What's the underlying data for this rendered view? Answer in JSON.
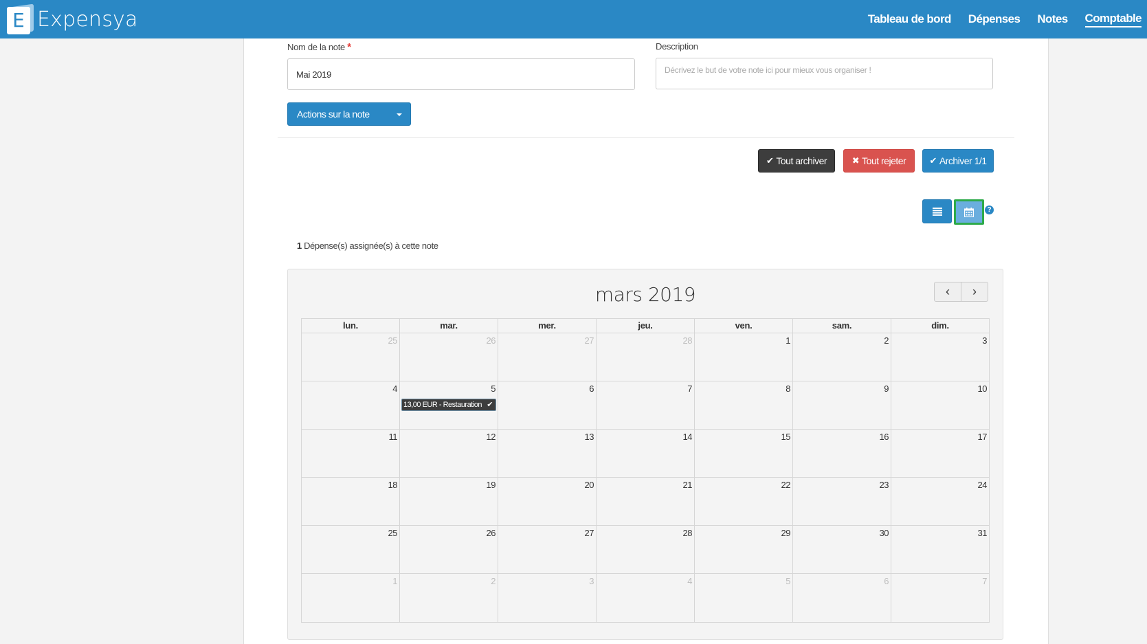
{
  "nav": {
    "logo_letter": "E",
    "brand": "Expensya",
    "links": [
      "Tableau de bord",
      "Dépenses",
      "Notes",
      "Comptable"
    ],
    "active_link": "Comptable"
  },
  "form": {
    "name_label": "Nom de la note",
    "required_mark": "*",
    "name_value": "Mai 2019",
    "description_label": "Description",
    "description_placeholder": "Décrivez le but de votre note ici pour mieux vous organiser !",
    "actions_label": "Actions sur la note"
  },
  "toolbar": {
    "archive_all": "Tout archiver",
    "reject_all": "Tout rejeter",
    "archive_count": "Archiver 1/1",
    "help": "?"
  },
  "assigned": {
    "count": "1",
    "text": "Dépense(s) assignée(s) à cette note"
  },
  "calendar": {
    "title": "mars 2019",
    "prev": "‹",
    "next": "›",
    "weekdays": [
      "lun.",
      "mar.",
      "mer.",
      "jeu.",
      "ven.",
      "sam.",
      "dim."
    ],
    "weeks": [
      [
        {
          "d": "25",
          "o": true
        },
        {
          "d": "26",
          "o": true
        },
        {
          "d": "27",
          "o": true
        },
        {
          "d": "28",
          "o": true
        },
        {
          "d": "1"
        },
        {
          "d": "2"
        },
        {
          "d": "3"
        }
      ],
      [
        {
          "d": "4"
        },
        {
          "d": "5",
          "event": "13,00 EUR - Restauration"
        },
        {
          "d": "6"
        },
        {
          "d": "7"
        },
        {
          "d": "8"
        },
        {
          "d": "9"
        },
        {
          "d": "10"
        }
      ],
      [
        {
          "d": "11"
        },
        {
          "d": "12"
        },
        {
          "d": "13"
        },
        {
          "d": "14"
        },
        {
          "d": "15"
        },
        {
          "d": "16"
        },
        {
          "d": "17"
        }
      ],
      [
        {
          "d": "18"
        },
        {
          "d": "19"
        },
        {
          "d": "20"
        },
        {
          "d": "21"
        },
        {
          "d": "22"
        },
        {
          "d": "23"
        },
        {
          "d": "24"
        }
      ],
      [
        {
          "d": "25"
        },
        {
          "d": "26"
        },
        {
          "d": "27"
        },
        {
          "d": "28"
        },
        {
          "d": "29"
        },
        {
          "d": "30"
        },
        {
          "d": "31"
        }
      ],
      [
        {
          "d": "1",
          "o": true
        },
        {
          "d": "2",
          "o": true
        },
        {
          "d": "3",
          "o": true
        },
        {
          "d": "4",
          "o": true
        },
        {
          "d": "5",
          "o": true
        },
        {
          "d": "6",
          "o": true
        },
        {
          "d": "7",
          "o": true
        }
      ]
    ]
  }
}
